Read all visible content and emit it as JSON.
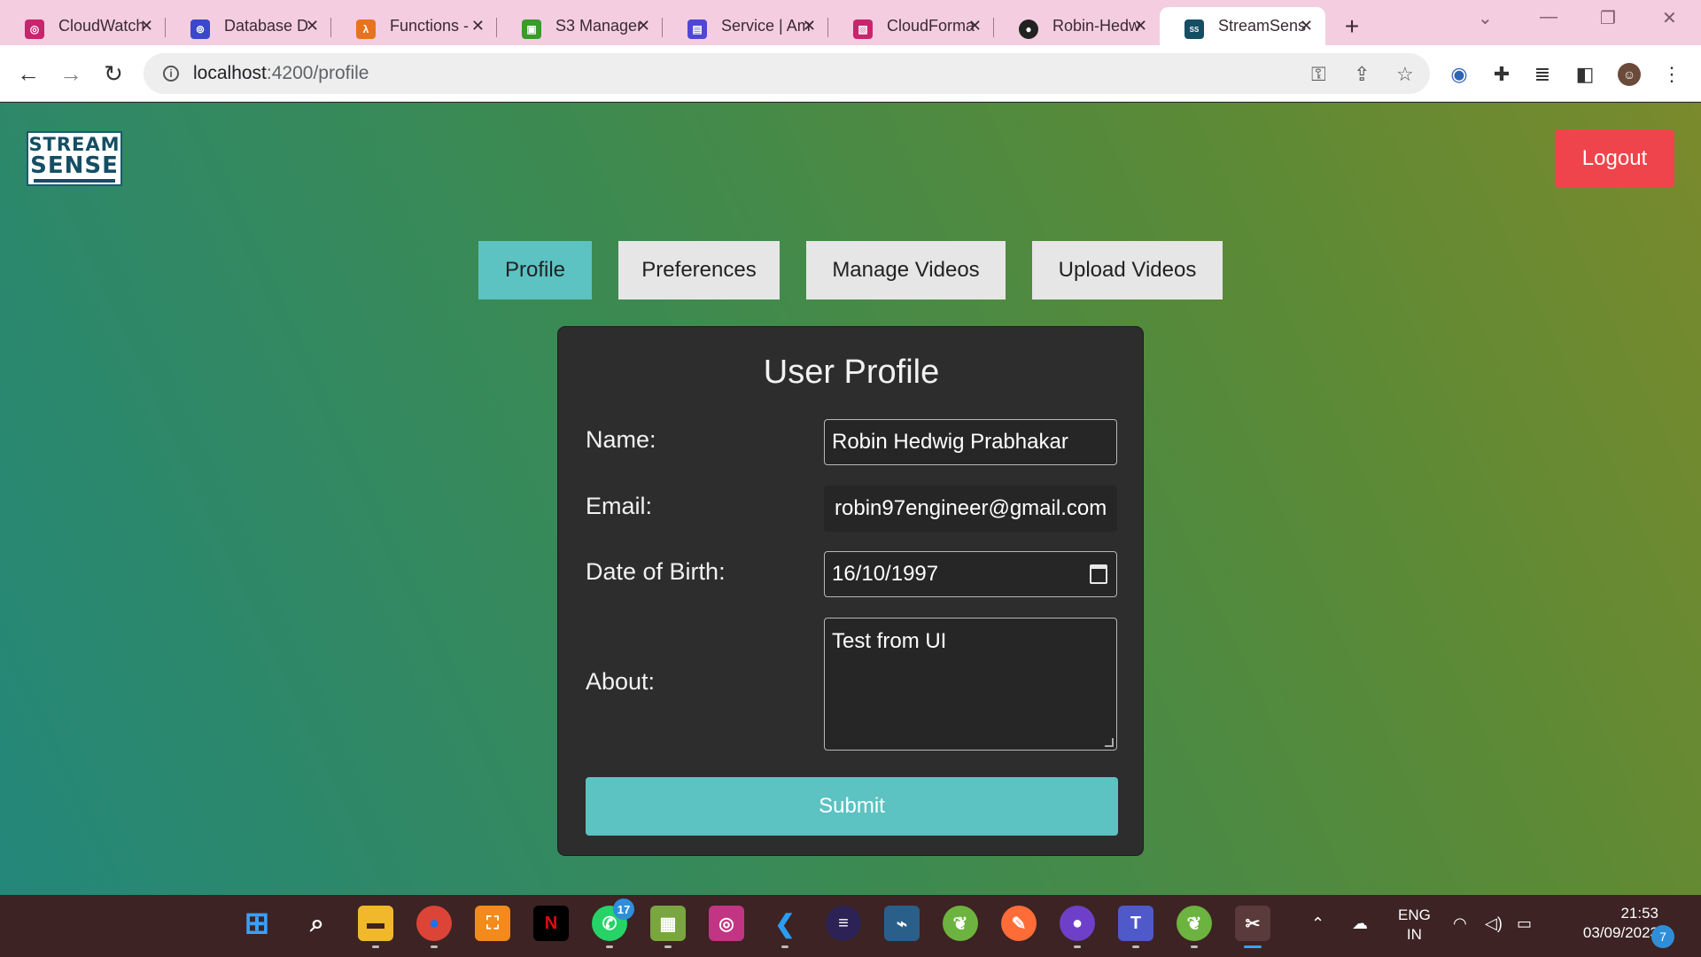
{
  "browser": {
    "tabs": [
      {
        "title": "CloudWatch",
        "icon": "cloudwatch-icon",
        "color": "#c7256d"
      },
      {
        "title": "Database D",
        "icon": "database-icon",
        "color": "#3b48cc"
      },
      {
        "title": "Functions -",
        "icon": "lambda-icon",
        "color": "#e8731c"
      },
      {
        "title": "S3 Manager",
        "icon": "s3-icon",
        "color": "#3a9a2a"
      },
      {
        "title": "Service | Am",
        "icon": "service-icon",
        "color": "#5046d6"
      },
      {
        "title": "CloudForma",
        "icon": "cloudformation-icon",
        "color": "#c7256d"
      },
      {
        "title": "Robin-Hedw",
        "icon": "github-icon",
        "color": "#222222"
      },
      {
        "title": "StreamSens",
        "icon": "streamsense-icon",
        "color": "#154e63"
      }
    ],
    "new_tab": "+",
    "url_host": "localhost",
    "url_path": ":4200/profile"
  },
  "app": {
    "logo_line1": "STREAM",
    "logo_line2": "SENSE",
    "logout_label": "Logout",
    "nav": [
      "Profile",
      "Preferences",
      "Manage Videos",
      "Upload Videos"
    ],
    "active_nav": "Profile"
  },
  "profile": {
    "title": "User Profile",
    "name_label": "Name:",
    "name_value": "Robin Hedwig Prabhakar",
    "email_label": "Email:",
    "email_value": "robin97engineer@gmail.com",
    "dob_label": "Date of Birth:",
    "dob_value": "16/10/1997",
    "about_label": "About:",
    "about_value": "Test from UI",
    "submit_label": "Submit"
  },
  "taskbar": {
    "whatsapp_badge": "17",
    "lang_line1": "ENG",
    "lang_line2": "IN",
    "time": "21:53",
    "date": "03/09/2023",
    "notifications": "7"
  },
  "colors": {
    "accent": "#5dc2c2",
    "logout": "#f0444c",
    "card": "#2d2d2d"
  }
}
